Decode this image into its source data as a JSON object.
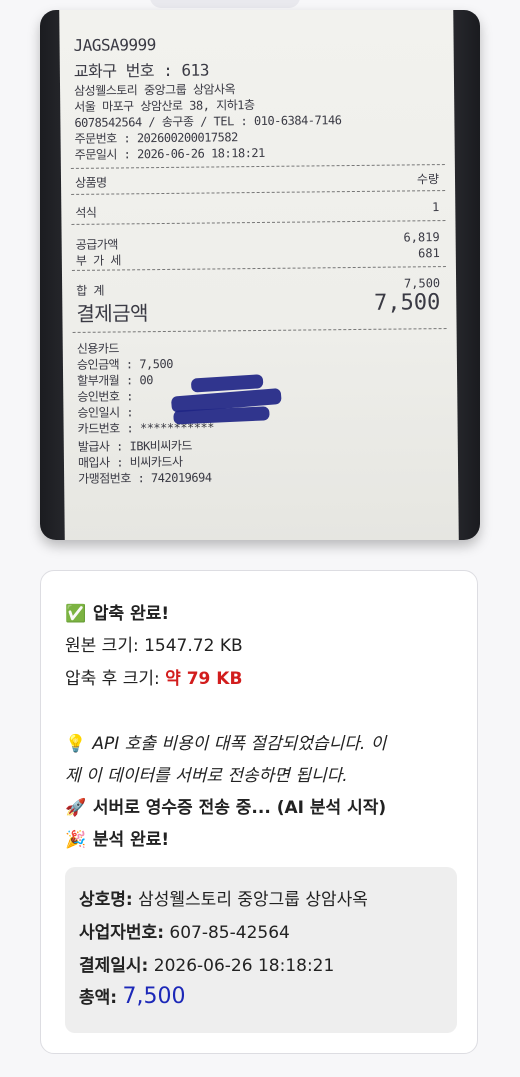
{
  "receipt_photo": {
    "lines": [
      "JAGSA9999",
      "교화구 번호 : 613",
      "삼성웰스토리 중앙그룹 상암사옥",
      "서울 마포구 상암산로 38, 지하1층",
      "6078542564 / 송구종 / TEL : 010-6384-7146",
      "주문번호 : 202600200017582",
      "주문일시 : 2026-06-26 18:18:21"
    ],
    "col_item": "상품명",
    "col_qty": "수량",
    "item_name": "석식",
    "item_qty": "1",
    "supply_label": "공급가액",
    "supply_value": "6,819",
    "vat_label": "부 가 세",
    "vat_value": "681",
    "sum_label": "합 계",
    "sum_value": "7,500",
    "pay_label": "결제금액",
    "pay_value": "7,500",
    "card_lines": [
      "신용카드",
      "승인금액 : 7,500",
      "할부개월 : 00",
      "승인번호 :",
      "승인일시 :",
      "카드번호 :                ***********",
      "발급사 : IBK비씨카드",
      "매입사 : 비씨카드사",
      "가맹점번호 : 742019694"
    ]
  },
  "message": {
    "done_emoji": "✅",
    "done_text": "압축 완료!",
    "orig_label": "원본 크기:",
    "orig_value": "1547.72 KB",
    "comp_label": "압축 후 크기:",
    "comp_value": "약 79 KB",
    "tip_emoji": "💡",
    "tip_line1": "API 호출 비용이 대폭 절감되었습니다. 이",
    "tip_line2": "제 이 데이터를 서버로 전송하면 됩니다.",
    "send_emoji": "🚀",
    "send_text": "서버로 영수증 전송 중... (AI 분석 시작)",
    "analysis_emoji": "🎉",
    "analysis_text": "분석 완료!"
  },
  "result": {
    "store_label": "상호명:",
    "store_value": "삼성웰스토리 중앙그룹 상암사옥",
    "biz_label": "사업자번호:",
    "biz_value": "607-85-42564",
    "date_label": "결제일시:",
    "date_value": "2026-06-26 18:18:21",
    "total_label": "총액:",
    "total_value": "7,500"
  },
  "colors": {
    "highlight_red": "#d21d1d",
    "amount_blue": "#1c28b8"
  }
}
